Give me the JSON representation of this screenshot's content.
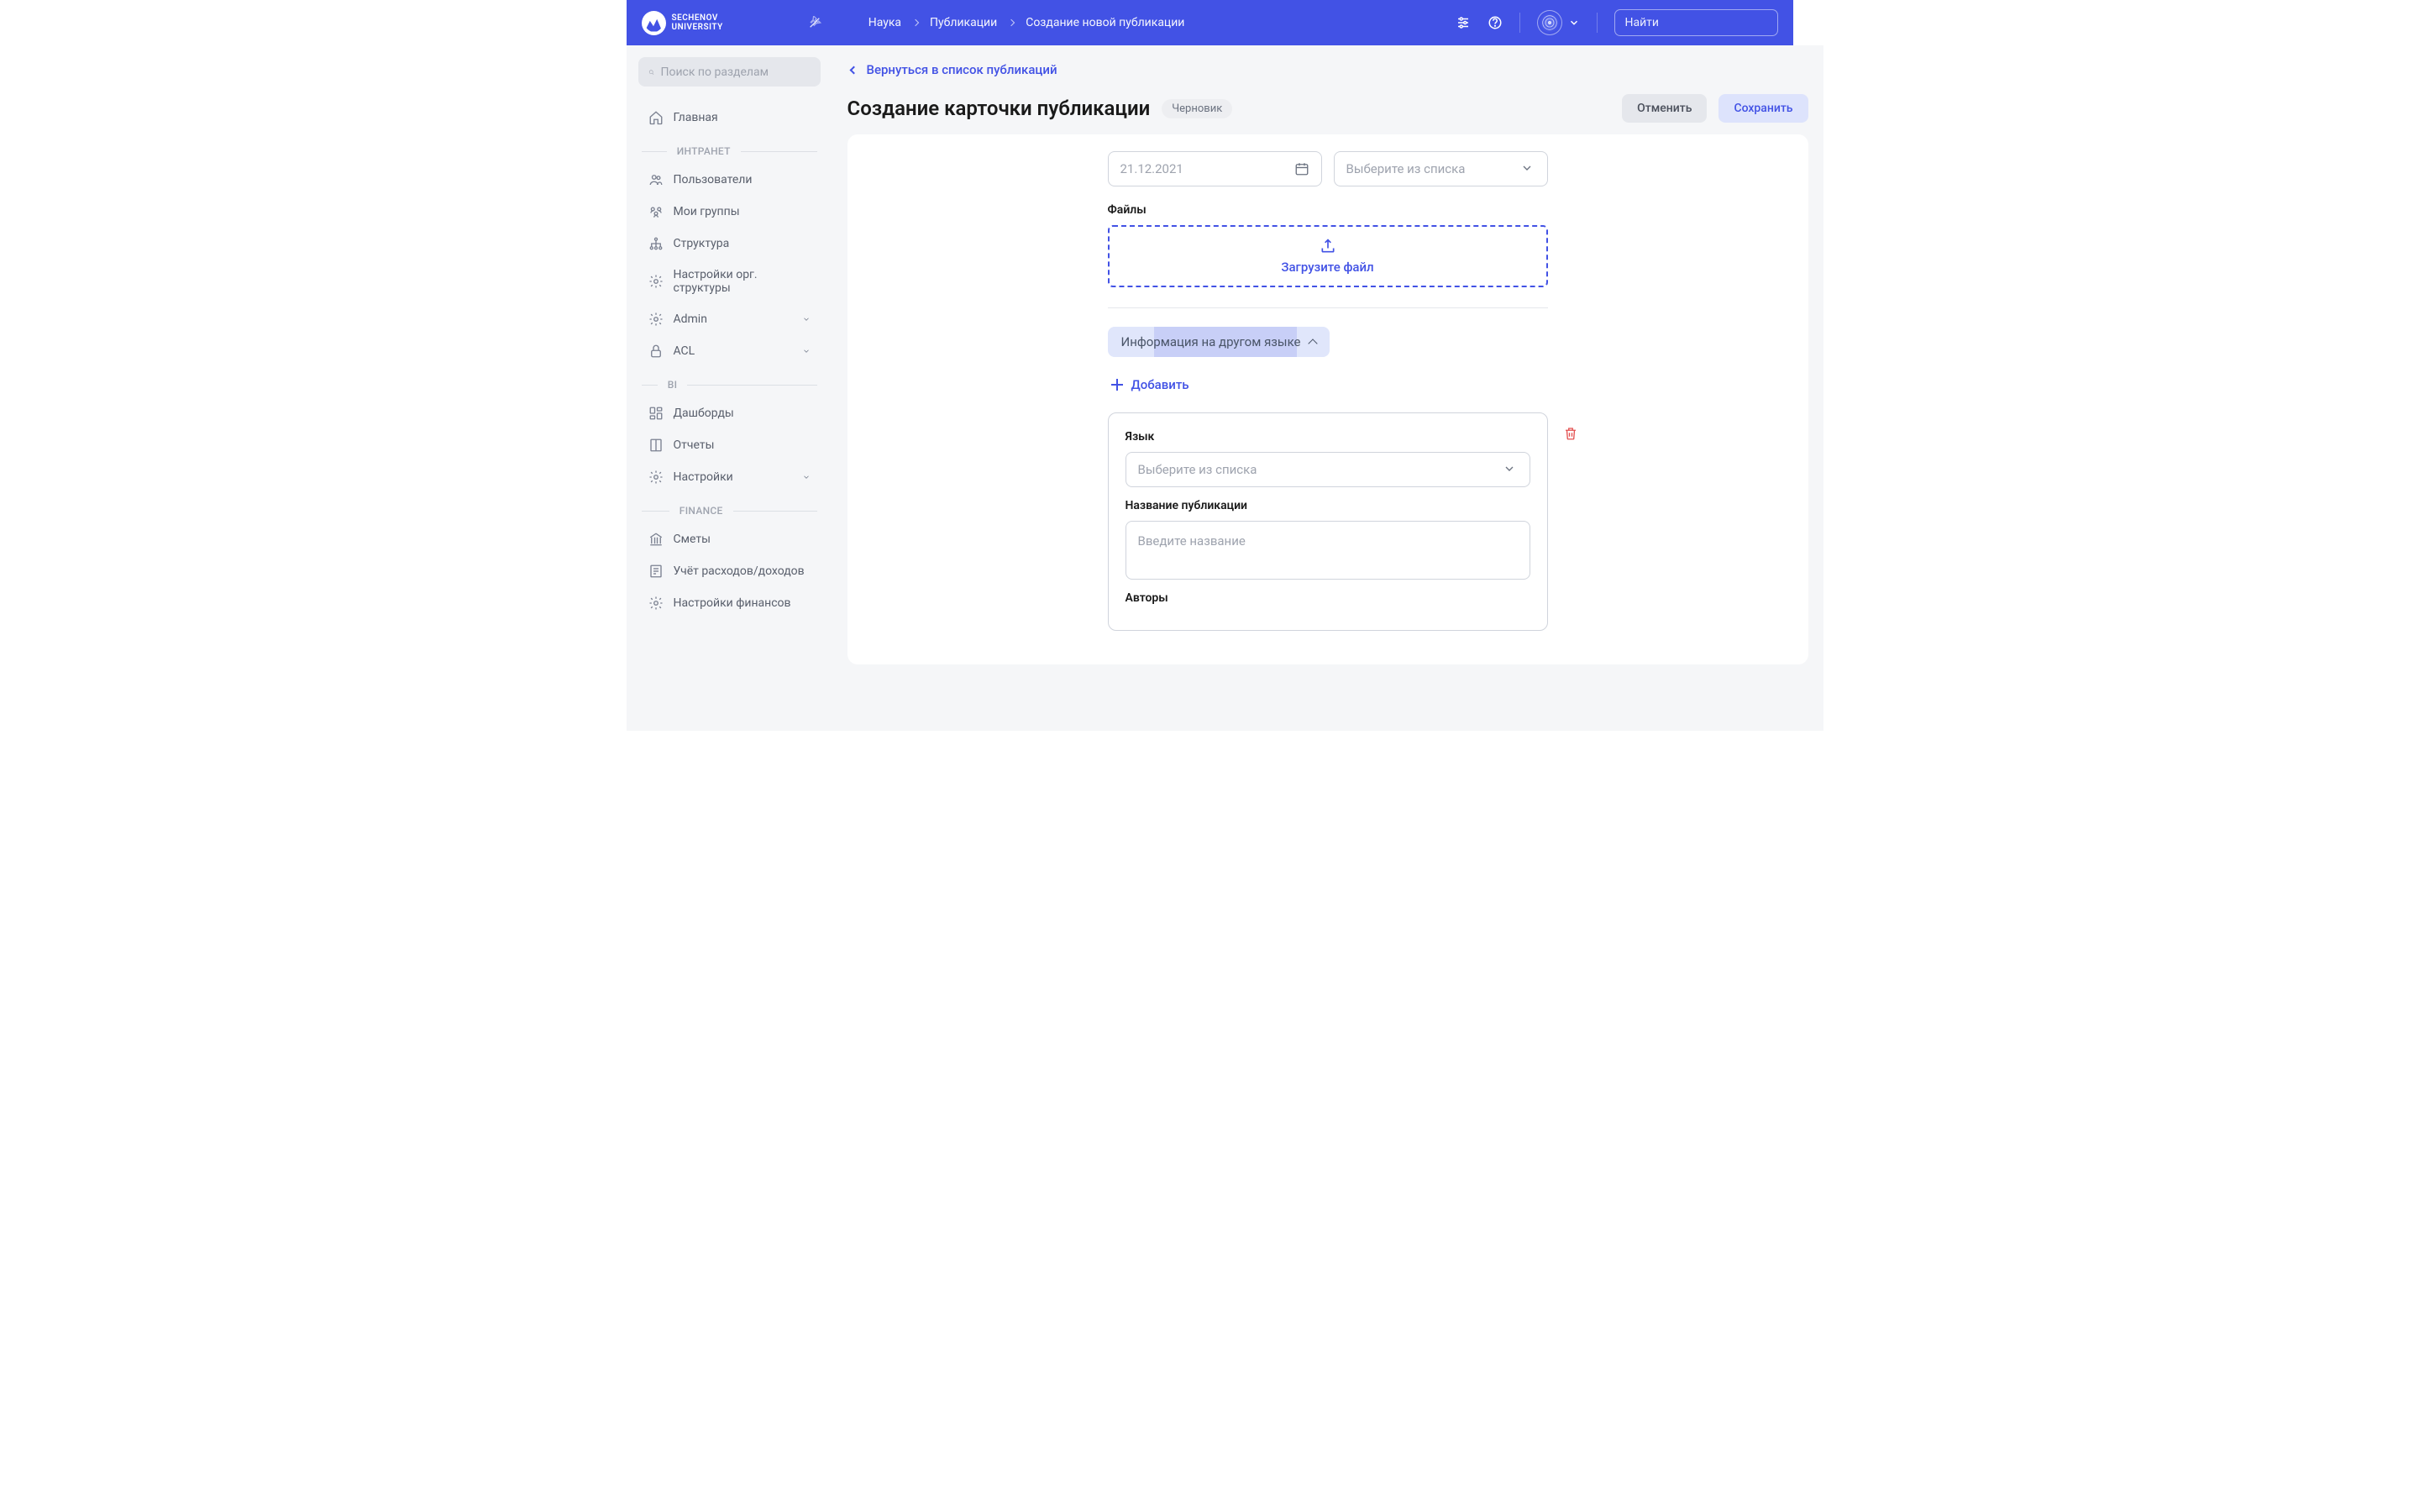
{
  "brand": {
    "line1": "SECHENOV",
    "line2": "UNIVERSITY"
  },
  "breadcrumb": {
    "a": "Наука",
    "b": "Публикации",
    "c": "Создание новой публикации"
  },
  "header": {
    "search_placeholder": "Найти"
  },
  "sidebar": {
    "search_placeholder": "Поиск по разделам",
    "home": "Главная",
    "group_intranet": "ИНТРАНЕТ",
    "users": "Пользователи",
    "groups": "Мои группы",
    "structure": "Структура",
    "org_settings": "Настройки орг. структуры",
    "admin": "Admin",
    "acl": "ACL",
    "group_bi": "BI",
    "dashboards": "Дашборды",
    "reports": "Отчеты",
    "settings": "Настройки",
    "group_finance": "FINANCE",
    "estimates": "Сметы",
    "expenses": "Учёт расходов/доходов",
    "fin_settings": "Настройки финансов"
  },
  "main": {
    "back": "Вернуться в список публикаций",
    "title": "Создание карточки публикации",
    "status": "Черновик",
    "cancel": "Отменить",
    "save": "Сохранить",
    "date_placeholder": "21.12.2021",
    "select_placeholder": "Выберите из списка",
    "files_label": "Файлы",
    "upload_text": "Загрузите файл",
    "other_lang": "Информация на другом языке",
    "add": "Добавить",
    "lang_label": "Язык",
    "pub_name_label": "Название публикации",
    "pub_name_placeholder": "Введите название",
    "authors_label": "Авторы"
  }
}
